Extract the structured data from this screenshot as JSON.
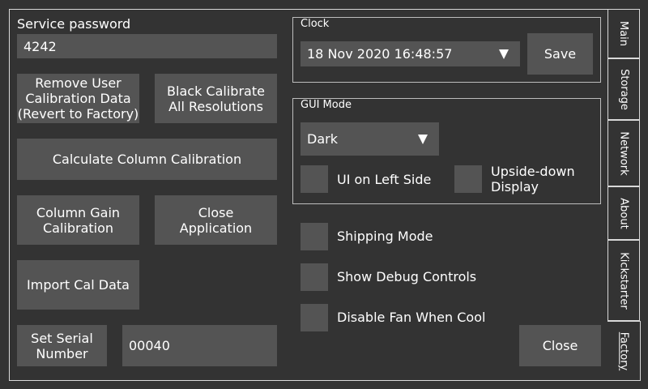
{
  "service_password": {
    "label": "Service password",
    "value": "4242"
  },
  "buttons": {
    "remove_user_cal": "Remove User\nCalibration Data\n(Revert to Factory)",
    "black_calibrate": "Black Calibrate\nAll Resolutions",
    "calc_column_cal": "Calculate Column Calibration",
    "column_gain_cal": "Column Gain\nCalibration",
    "close_application": "Close\nApplication",
    "import_cal_data": "Import Cal Data",
    "set_serial": "Set Serial\nNumber",
    "serial_value": "00040",
    "save": "Save",
    "close": "Close"
  },
  "clock": {
    "label": "Clock",
    "value": "18 Nov 2020 16:48:57"
  },
  "gui_mode": {
    "label": "GUI Mode",
    "selected": "Dark",
    "ui_left_side": "UI on Left Side",
    "upside_down": "Upside-down\nDisplay"
  },
  "options": {
    "shipping_mode": "Shipping Mode",
    "show_debug": "Show Debug Controls",
    "disable_fan": "Disable Fan When Cool"
  },
  "tabs": [
    "Main",
    "Storage",
    "Network",
    "About",
    "Kickstarter",
    "Factory"
  ],
  "active_tab": "Factory",
  "icons": {
    "dropdown": "triangle-down-icon"
  }
}
